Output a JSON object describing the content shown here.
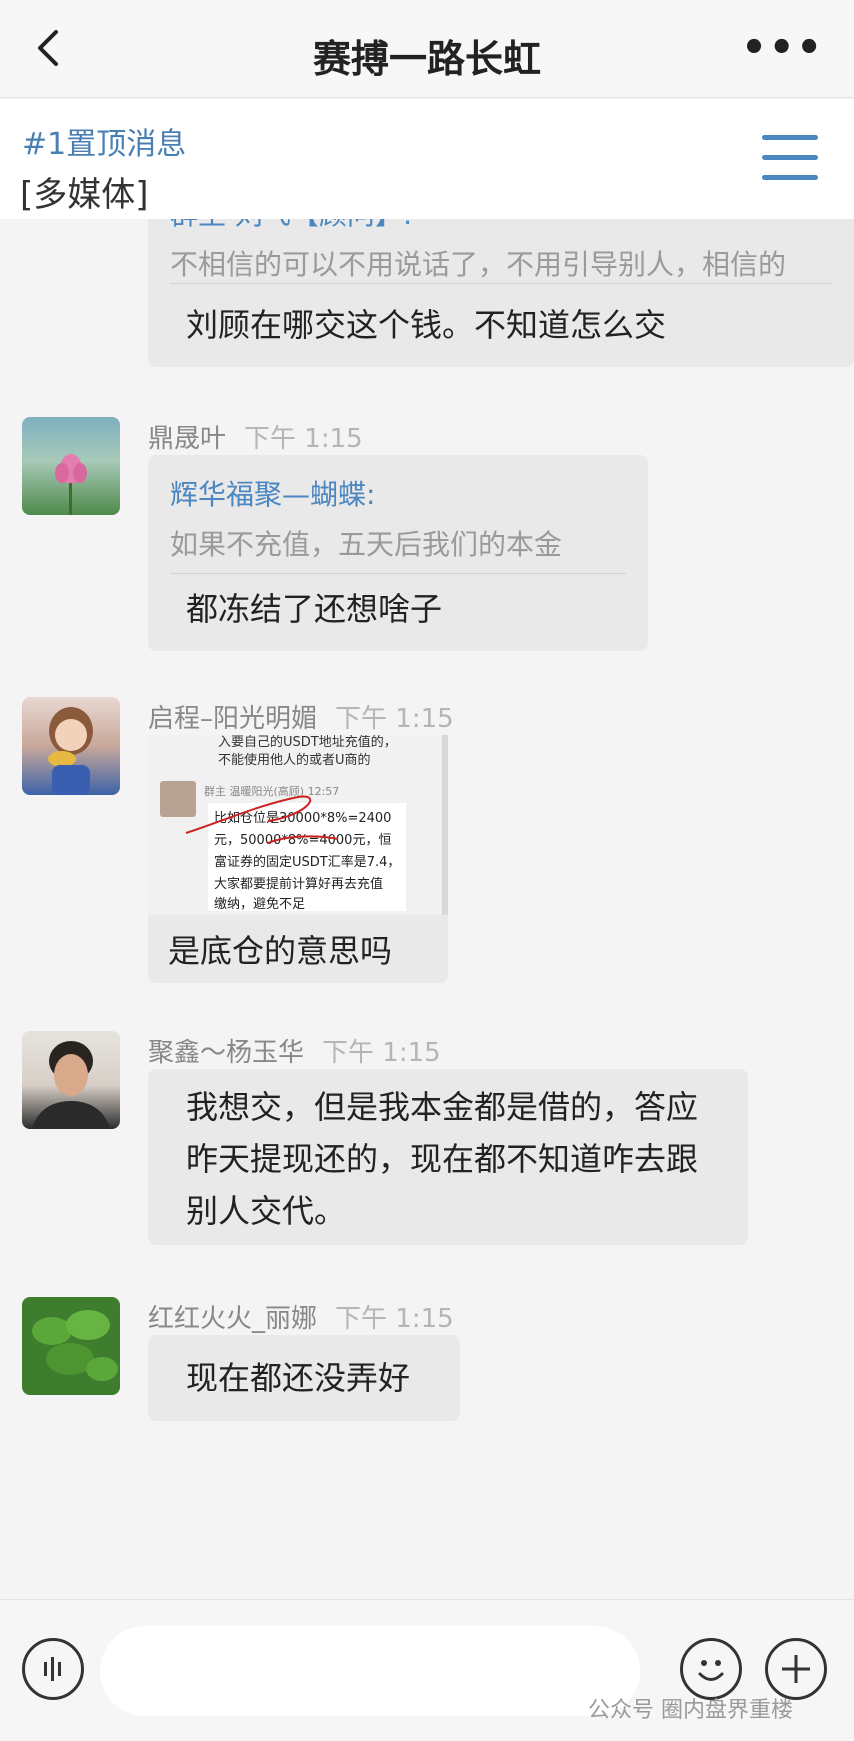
{
  "header": {
    "title": "赛搏一路长虹",
    "more_label": "•••"
  },
  "pinned": {
    "title": "#1置顶消息",
    "media": "[多媒体]"
  },
  "messages": [
    {
      "sender": "",
      "time": "",
      "quote_name": "群主 刘飞【顾问】:",
      "quote_text": "不相信的可以不用说话了，不用引导别人，相信的",
      "text": "刘顾在哪交这个钱。不知道怎么交"
    },
    {
      "sender": "鼎晟叶",
      "time": "下午 1:15",
      "quote_name": "辉华福聚—蝴蝶:",
      "quote_text": "如果不充值，五天后我们的本金",
      "text": "都冻结了还想啥子"
    },
    {
      "sender": "启程–阳光明媚",
      "time": "下午 1:15",
      "image_lines": [
        "入要自己的USDT地址充值的，",
        "不能使用他人的或者U商的",
        "群主  温暖阳光(高顾)  12:57",
        "比如仓位是30000*8%=2400",
        "元，50000*8%=4000元，恒",
        "富证券的固定USDT汇率是7.4，",
        "大家都要提前计算好再去充值",
        "缴纳，避免不足"
      ],
      "text": "是底仓的意思吗"
    },
    {
      "sender": "聚鑫～杨玉华",
      "time": "下午 1:15",
      "text": "我想交，但是我本金都是借的，答应昨天提现还的，现在都不知道咋去跟别人交代。"
    },
    {
      "sender": "红红火火_丽娜",
      "time": "下午 1:15",
      "text": "现在都还没弄好"
    }
  ],
  "input_bar": {
    "watermark": "公众号 圈内盘界重楼"
  },
  "colors": {
    "link_blue": "#4a86c0",
    "bubble": "#e9e9e9",
    "background": "#f4f4f4"
  }
}
